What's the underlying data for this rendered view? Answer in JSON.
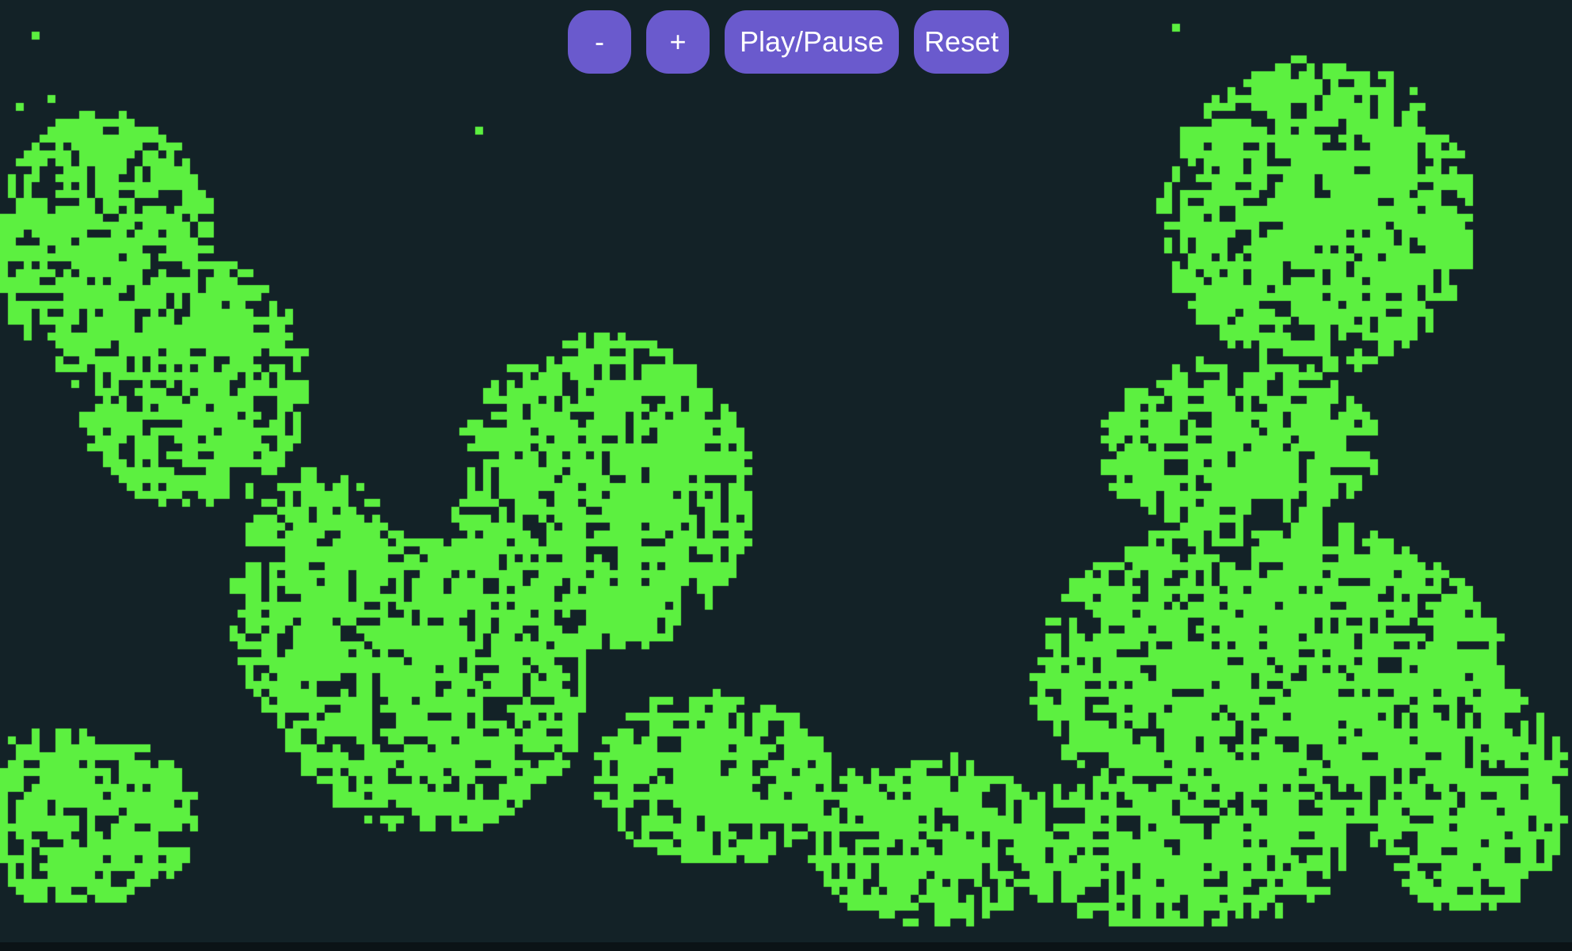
{
  "controls": {
    "decrease_label": "-",
    "increase_label": "+",
    "play_pause_label": "Play/Pause",
    "reset_label": "Reset"
  },
  "board": {
    "cell_color": "#5cf040",
    "background_color": "#132227",
    "button_color": "#6a5acd",
    "button_text_color": "#ffffff"
  }
}
